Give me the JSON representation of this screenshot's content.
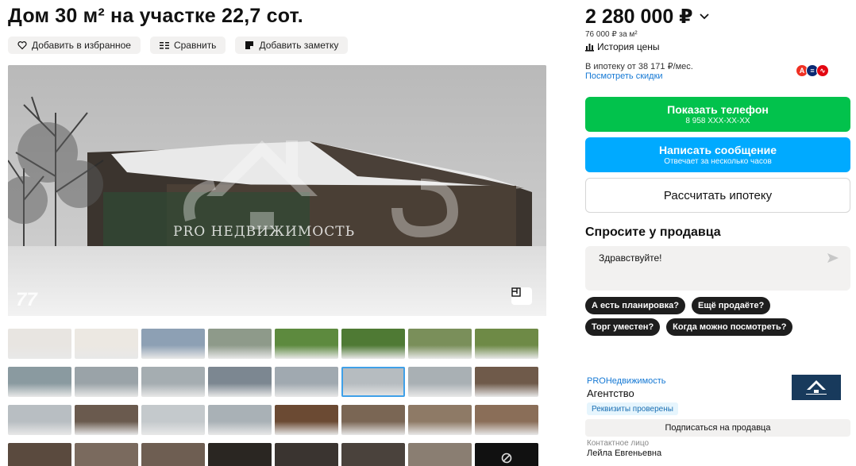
{
  "listing": {
    "title": "Дом 30 м² на участке 22,7 сот.",
    "actions": {
      "favorite": "Добавить в избранное",
      "compare": "Сравнить",
      "note": "Добавить заметку"
    },
    "photo": {
      "count": "77",
      "watermark": "PRO НЕДВИЖИМОСТЬ"
    },
    "thumbnails": [
      {
        "bg": "#e8e5e1"
      },
      {
        "bg": "#ece8e2"
      },
      {
        "bg": "#8da0b4"
      },
      {
        "bg": "#8e9a8a"
      },
      {
        "bg": "#5d8a3e"
      },
      {
        "bg": "#4f7a34"
      },
      {
        "bg": "#7a8f5a"
      },
      {
        "bg": "#6e8a46"
      },
      {
        "bg": "#8a9aa0"
      },
      {
        "bg": "#9aa3a8"
      },
      {
        "bg": "#a5adb1"
      },
      {
        "bg": "#7c8791"
      },
      {
        "bg": "#a0a9b0"
      },
      {
        "bg": "#b6bcc0"
      },
      {
        "bg": "#a9b0b4"
      },
      {
        "bg": "#6f5a4a"
      },
      {
        "bg": "#b8bec2"
      },
      {
        "bg": "#6a5a4e"
      },
      {
        "bg": "#c4c9cc"
      },
      {
        "bg": "#a9b1b6"
      },
      {
        "bg": "#6b4a33"
      },
      {
        "bg": "#7a6654"
      },
      {
        "bg": "#8e7a66"
      },
      {
        "bg": "#8a6e58"
      },
      {
        "bg": "#5a4a3e"
      },
      {
        "bg": "#7a6a5e"
      },
      {
        "bg": "#6e5e52"
      },
      {
        "bg": "#2a2622"
      },
      {
        "bg": "#3a3430"
      },
      {
        "bg": "#4a423c"
      },
      {
        "bg": "#8a7e72"
      }
    ]
  },
  "sidebar": {
    "price": "2 280 000 ₽",
    "price_per_m": "76 000 ₽ за м²",
    "price_history": "История цены",
    "mortgage": "В ипотеку от 38 171 ₽/мес.",
    "discounts": "Посмотреть скидки",
    "phone_button": {
      "label": "Показать телефон",
      "sub": "8 958 XXX-XX-XX"
    },
    "message_button": {
      "label": "Написать сообщение",
      "sub": "Отвечает за несколько часов"
    },
    "mortgage_button": "Рассчитать ипотеку",
    "ask_title": "Спросите у продавца",
    "ask_input": "Здравствуйте!",
    "quick_questions": [
      "А есть планировка?",
      "Ещё продаёте?",
      "Торг уместен?",
      "Когда можно посмотреть?"
    ],
    "agency": {
      "name": "PROНедвижимость",
      "type": "Агентство",
      "verified": "Реквизиты проверены",
      "subscribe": "Подписаться на продавца"
    },
    "contact": {
      "label": "Контактное лицо",
      "name": "Лейла Евгеньевна"
    }
  },
  "colors": {
    "green": "#02c24c",
    "blue": "#00aaff",
    "link": "#1478d4",
    "bank_alfa": "#ef3124",
    "bank_vtb": "#0a2973",
    "bank_mts": "#e30611"
  }
}
